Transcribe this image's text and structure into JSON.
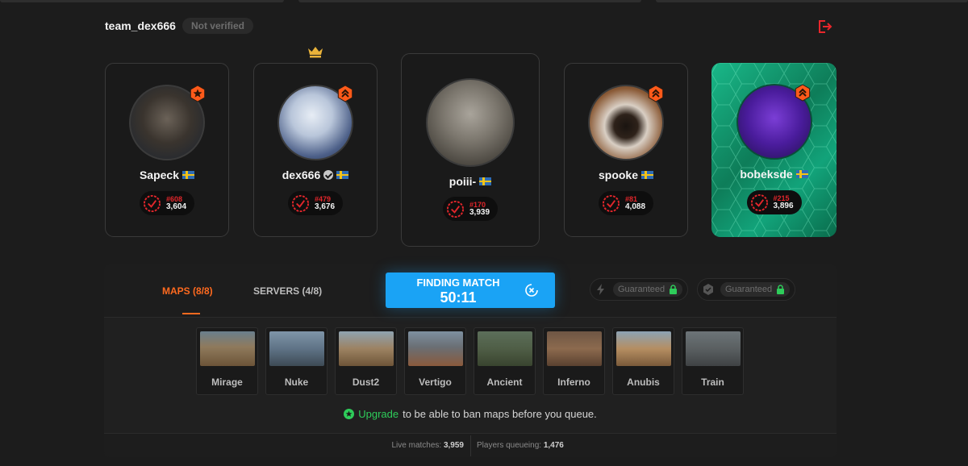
{
  "team": {
    "name": "team_dex666",
    "status": "Not verified"
  },
  "players": [
    {
      "name": "Sapeck",
      "rank": "#608",
      "elo": "3,604",
      "verified": false,
      "crown": false
    },
    {
      "name": "dex666",
      "rank": "#479",
      "elo": "3,676",
      "verified": true,
      "crown": true
    },
    {
      "name": "poiii-",
      "rank": "#170",
      "elo": "3,939",
      "verified": false,
      "crown": false
    },
    {
      "name": "spooke",
      "rank": "#81",
      "elo": "4,088",
      "verified": false,
      "crown": false
    },
    {
      "name": "bobeksde",
      "rank": "#215",
      "elo": "3,896",
      "verified": false,
      "crown": false
    }
  ],
  "tabs": {
    "maps": "MAPS (8/8)",
    "servers": "SERVERS (4/8)"
  },
  "queue": {
    "status": "FINDING MATCH",
    "timer": "50:11"
  },
  "guarantees": [
    {
      "icon": "lightning-icon",
      "label": "Guaranteed"
    },
    {
      "icon": "anti-cheat-icon",
      "label": "Guaranteed"
    }
  ],
  "maps": [
    "Mirage",
    "Nuke",
    "Dust2",
    "Vertigo",
    "Ancient",
    "Inferno",
    "Anubis",
    "Train"
  ],
  "upgrade": {
    "link": "Upgrade",
    "text": "to be able to ban maps before you queue."
  },
  "stats": {
    "live_label": "Live matches:",
    "live_value": "3,959",
    "players_label": "Players queueing:",
    "players_value": "1,476"
  },
  "colors": {
    "accent": "#ff6a1f",
    "queue_button": "#1aa3f5",
    "rank_red": "#e2262b",
    "upgrade_green": "#2ecc5a",
    "premium_card": "#12a37a"
  }
}
